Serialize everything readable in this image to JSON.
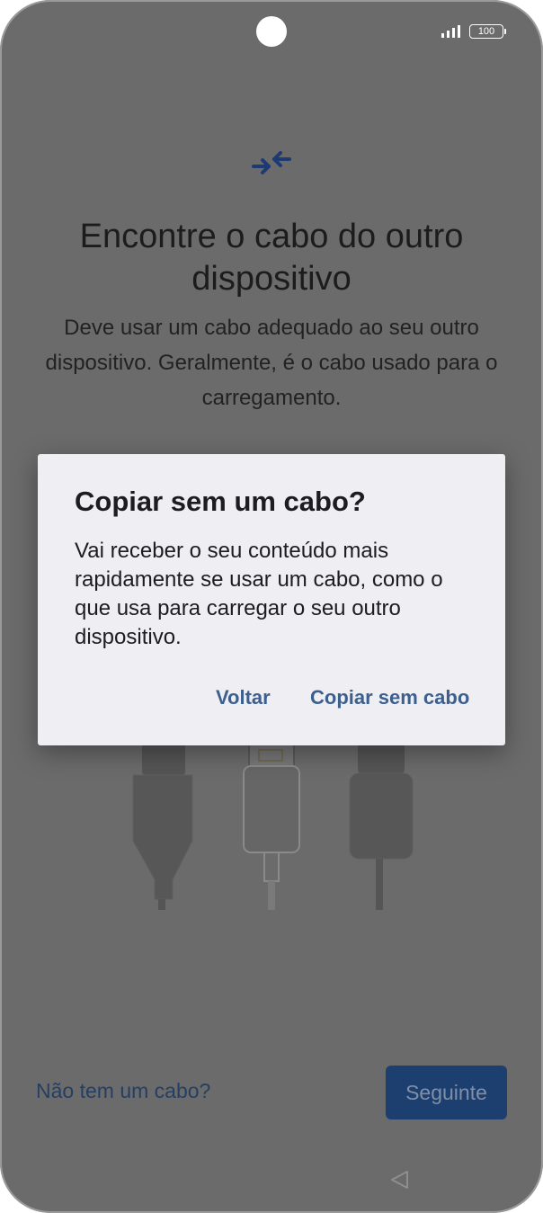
{
  "status_bar": {
    "battery": "100",
    "signal_icon": "signal-bars-icon",
    "battery_icon": "battery-icon"
  },
  "screen": {
    "header_icon": "connect-arrows-icon",
    "title": "Encontre o cabo do outro dispositivo",
    "subtitle": "Deve usar um cabo adequado ao seu outro dispositivo. Geralmente, é o cabo usado para o carregamento.",
    "illustration": "cable-connectors-illustration",
    "no_cable_link": "Não tem um cabo?",
    "next_button": "Seguinte"
  },
  "dialog": {
    "title": "Copiar sem um cabo?",
    "body": "Vai receber o seu conteúdo mais rapidamente se usar um cabo, como o que usa para carregar o seu outro dispositivo.",
    "back_button": "Voltar",
    "confirm_button": "Copiar sem cabo"
  },
  "nav": {
    "back_icon": "back-triangle-icon"
  },
  "colors": {
    "scrim_background": "#6b6b6b",
    "dialog_background": "#eeeef3",
    "accent": "#3c5f8e",
    "primary_button": "#1c3f6f",
    "icon_blue": "#1e3a72"
  }
}
